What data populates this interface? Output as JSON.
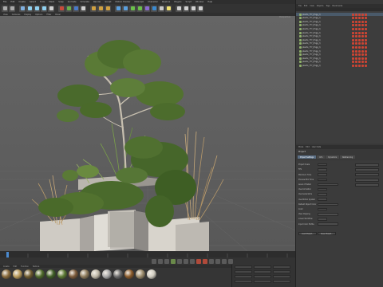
{
  "menubar": {
    "items": [
      "File",
      "Edit",
      "Create",
      "Select",
      "Tools",
      "Mesh",
      "Snap",
      "Animate",
      "Simulate",
      "Render",
      "Sculpt",
      "Motion Tracker",
      "MoGraph",
      "Character",
      "Pipeline",
      "Plugins",
      "Script",
      "Window",
      "Help"
    ]
  },
  "viewport": {
    "menu": [
      "View",
      "Cameras",
      "Display",
      "Options",
      "Filter",
      "Panel"
    ],
    "label": "Perspective"
  },
  "materials": {
    "menu": [
      "Create",
      "Edit",
      "Function",
      "Texture"
    ],
    "swatches": [
      "#8a6b3c",
      "#b99a5a",
      "#6e5a2e",
      "#4e6a2a",
      "#3f5e26",
      "#5b7a34",
      "#7b5a3a",
      "#8d7a5a",
      "#c0b9a8",
      "#a8a8a8",
      "#6a6a6a",
      "#8a5a2a",
      "#9a8a6a",
      "#d0ccc0"
    ]
  },
  "object_manager": {
    "menu": [
      "File",
      "Edit",
      "View",
      "Objects",
      "Tags",
      "Bookmarks"
    ],
    "objects": [
      {
        "name": "plants_???_(fogg_l)",
        "tags": [
          "#c43",
          "#c43",
          "#c43",
          "#c43",
          "#c43"
        ]
      },
      {
        "name": "plants_???_(fogg_l)",
        "tags": [
          "#c43",
          "#c43",
          "#c43",
          "#c43",
          "#c43"
        ]
      },
      {
        "name": "plants_???_(fogg_l)",
        "tags": [
          "#c43",
          "#c43",
          "#c43",
          "#c43",
          "#c43"
        ]
      },
      {
        "name": "plants_???_(fogg_l)",
        "tags": [
          "#c43",
          "#c43",
          "#c43",
          "#c43",
          "#c43"
        ]
      },
      {
        "name": "plants_???_(fogg_l)",
        "tags": [
          "#c43",
          "#c43",
          "#c43",
          "#c43",
          "#c43"
        ]
      },
      {
        "name": "plants_???_(fogg_l)",
        "tags": [
          "#c43",
          "#c43",
          "#c43",
          "#c43",
          "#c43"
        ]
      },
      {
        "name": "plants_???_(fogg_l)",
        "tags": [
          "#c43",
          "#c43",
          "#c43",
          "#c43",
          "#c43"
        ]
      },
      {
        "name": "plants_???_(fogg_l)",
        "tags": [
          "#c43",
          "#c43",
          "#c43",
          "#c43",
          "#c43"
        ]
      },
      {
        "name": "plants_???_(fogg_l)",
        "tags": [
          "#c43",
          "#c43",
          "#c43",
          "#c43",
          "#c43"
        ]
      },
      {
        "name": "plants_???_(fogg_l)",
        "tags": [
          "#c43",
          "#c43",
          "#c43",
          "#c43",
          "#c43"
        ]
      },
      {
        "name": "plants_???_(fogg_l)",
        "tags": [
          "#c43",
          "#c43",
          "#c43",
          "#c43",
          "#c43"
        ]
      },
      {
        "name": "plants_???_(fogg_l)",
        "tags": [
          "#c43",
          "#c43",
          "#c43",
          "#c43",
          "#c43"
        ]
      },
      {
        "name": "plants_???_(fogg_l)",
        "tags": [
          "#c43",
          "#c43",
          "#c43",
          "#c43",
          "#c43"
        ]
      },
      {
        "name": "plants_???_(fogg_l)",
        "tags": [
          "#c43",
          "#c43",
          "#c43",
          "#c43",
          "#c43"
        ]
      },
      {
        "name": "plants_???_(fogg_l)",
        "tags": [
          "#c43",
          "#c43",
          "#c43",
          "#c43",
          "#c43"
        ]
      }
    ]
  },
  "attribute_manager": {
    "menu": [
      "Mode",
      "Edit",
      "User Data"
    ],
    "title": "Project",
    "tabs": [
      "Project Settings",
      "Info",
      "Dynamics",
      "Referencing"
    ],
    "rows": [
      {
        "label": "Project Scale"
      },
      {
        "label": "FPS"
      },
      {
        "label": "Minimum Time"
      },
      {
        "label": "Preview Min Time"
      },
      {
        "label": "Level of Detail"
      },
      {
        "label": "Use Animation"
      },
      {
        "label": "Use Generators"
      },
      {
        "label": "Use Motion System"
      },
      {
        "label": "Default Object Color"
      },
      {
        "label": "Color"
      },
      {
        "label": "View Clipping"
      },
      {
        "label": "Linear Workflow"
      },
      {
        "label": "Input Color Profile"
      }
    ],
    "buttons": [
      "Load Preset...",
      "Save Preset..."
    ]
  },
  "colors": {
    "accent": "#5b6f85",
    "panel": "#383838",
    "viewport": "#5e5e5e"
  }
}
